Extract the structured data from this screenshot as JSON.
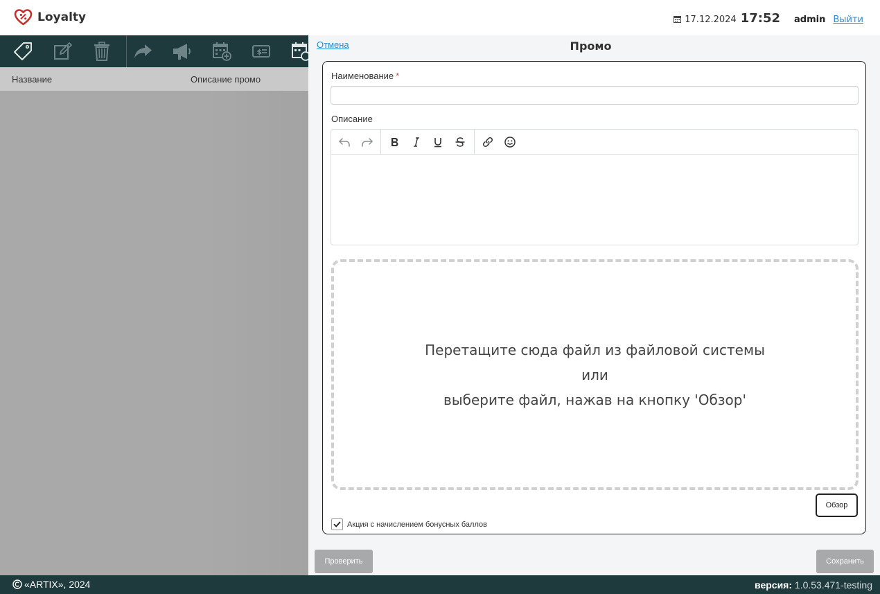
{
  "header": {
    "app_name": "Loyalty",
    "date": "17.12.2024",
    "time": "17:52",
    "user": "admin",
    "logout": "Выйти"
  },
  "list": {
    "columns": [
      "Название",
      "Описание промо"
    ]
  },
  "panel": {
    "cancel": "Отмена",
    "title": "Промо",
    "name_label": "Наименование",
    "required_mark": "*",
    "name_value": "",
    "description_label": "Описание",
    "dropzone": {
      "line1": "Перетащите сюда файл из файловой системы",
      "line2": "или",
      "line3": "выберите файл, нажав на кнопку 'Обзор'"
    },
    "browse": "Обзор",
    "bonus_checkbox_label": "Акция с начислением бонусных баллов",
    "bonus_checked": true,
    "check_button": "Проверить",
    "save_button": "Сохранить"
  },
  "footer": {
    "copyright": "«ARTIX», 2024",
    "version_label": "версия:",
    "version_value": "1.0.53.471-testing"
  },
  "colors": {
    "dark_bar": "#1e3a3d",
    "link": "#2b8fd6",
    "logo_red": "#c9302c",
    "disabled_button": "#a7a9ab"
  }
}
